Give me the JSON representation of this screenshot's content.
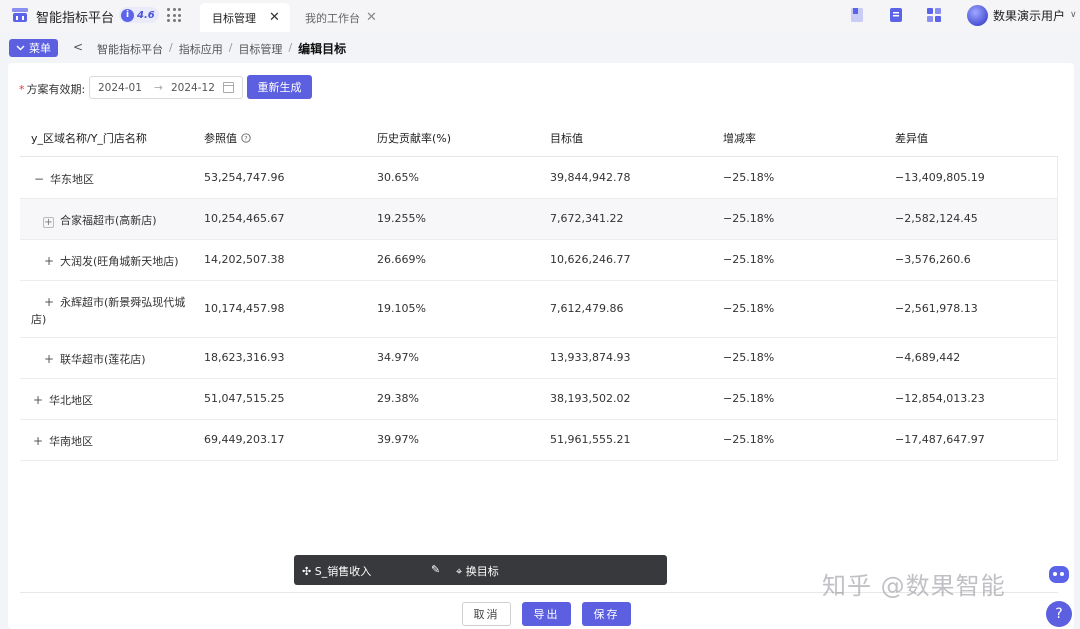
{
  "app": {
    "title": "智能指标平台",
    "version": "4.6",
    "version_badge": "i"
  },
  "tabs": [
    {
      "label": "目标管理",
      "active": true,
      "close": "✕"
    },
    {
      "label": "我的工作台",
      "active": false,
      "close": "✕"
    }
  ],
  "user": {
    "name": "数果演示用户",
    "chevron": "∨"
  },
  "menu_button": {
    "label": "菜单",
    "icon": "chevron-down-icon"
  },
  "breadcrumb": {
    "back": "<",
    "items": [
      "智能指标平台",
      "指标应用",
      "目标管理"
    ],
    "separator": "/",
    "current": "编辑目标"
  },
  "form": {
    "validity_label": "方案有效期:",
    "required_mark": "*",
    "date_start": "2024-01",
    "date_arrow": "→",
    "date_end": "2024-12",
    "regen_button": "重新生成"
  },
  "table": {
    "columns": [
      "y_区域名称/Y_门店名称",
      "参照值",
      "历史贡献率(%)",
      "目标值",
      "增减率",
      "差异值"
    ],
    "rows": [
      {
        "expander": "−",
        "name": "华东地区",
        "ref": "53,254,747.96",
        "contrib": "30.65%",
        "target": "39,844,942.78",
        "rate": "−25.18%",
        "diff": "−13,409,805.19"
      },
      {
        "expander": "+",
        "name": "合家福超市(高新店)",
        "ref": "10,254,465.67",
        "contrib": "19.255%",
        "target": "7,672,341.22",
        "rate": "−25.18%",
        "diff": "−2,582,124.45"
      },
      {
        "expander": "+",
        "name": "大润发(旺角城新天地店)",
        "ref": "14,202,507.38",
        "contrib": "26.669%",
        "target": "10,626,246.77",
        "rate": "−25.18%",
        "diff": "−3,576,260.6"
      },
      {
        "expander": "+",
        "name_line1": "永辉超市(新景舜弘现代城",
        "name_line2": "店)",
        "ref": "10,174,457.98",
        "contrib": "19.105%",
        "target": "7,612,479.86",
        "rate": "−25.18%",
        "diff": "−2,561,978.13"
      },
      {
        "expander": "+",
        "name": "联华超市(莲花店)",
        "ref": "18,623,316.93",
        "contrib": "34.97%",
        "target": "13,933,874.93",
        "rate": "−25.18%",
        "diff": "−4,689,442"
      },
      {
        "expander": "+",
        "name": "华北地区",
        "ref": "51,047,515.25",
        "contrib": "29.38%",
        "target": "38,193,502.02",
        "rate": "−25.18%",
        "diff": "−12,854,013.23"
      },
      {
        "expander": "+",
        "name": "华南地区",
        "ref": "69,449,203.17",
        "contrib": "39.97%",
        "target": "51,961,555.21",
        "rate": "−25.18%",
        "diff": "−17,487,647.97"
      }
    ]
  },
  "float_bar": {
    "move_label": "S_销售收入",
    "move_icon": "✣",
    "edit_icon": "✎",
    "target_icon": "⌖",
    "target_label": "换目标"
  },
  "footer": {
    "cancel": "取消",
    "export": "导出",
    "save": "保存"
  },
  "watermark": "知乎 @数果智能",
  "help": "?",
  "colors": {
    "accent": "#5b5fe0",
    "dark_bar": "#38393c"
  }
}
